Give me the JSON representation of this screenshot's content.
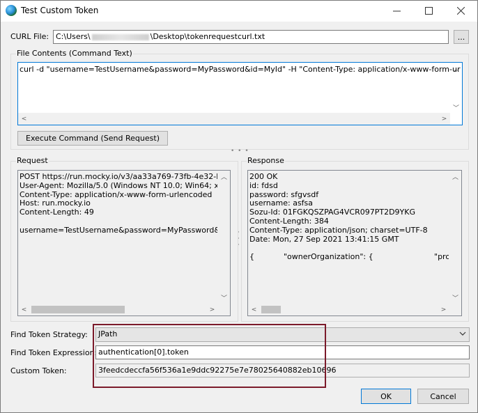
{
  "window": {
    "title": "Test Custom Token"
  },
  "curl_file": {
    "label": "CURL File:",
    "path_start": "C:\\Users\\",
    "path_end": "\\Desktop\\tokenrequestcurl.txt",
    "browse_label": "..."
  },
  "file_contents": {
    "title": "File Contents (Command Text)",
    "text": "curl -d \"username=TestUsername&password=MyPassword&id=MyId\" -H \"Content-Type: application/x-www-form-urlencoded\" -X PC",
    "execute_label": "Execute Command (Send Request)"
  },
  "request": {
    "title": "Request",
    "text": "POST https://run.mocky.io/v3/aa33a769-73fb-4e32-b766-c\nUser-Agent: Mozilla/5.0 (Windows NT 10.0; Win64; x64) SS\nContent-Type: application/x-www-form-urlencoded\nHost: run.mocky.io\nContent-Length: 49\n\nusername=TestUsername&password=MyPassword&id=MyId"
  },
  "response": {
    "title": "Response",
    "text": "200 OK\nid: fdsd\npassword: sfgvsdf\nusername: asfsa\nSozu-Id: 01FGKQSZPAG4VCR097PT2D9YKG\nContent-Length: 384\nContent-Type: application/json; charset=UTF-8\nDate: Mon, 27 Sep 2021 13:41:15 GMT\n\n{            \"ownerOrganization\": {                         \"providerl"
  },
  "strategy": {
    "label": "Find Token Strategy:",
    "value": "JPath"
  },
  "expression": {
    "label": "Find Token Expression:",
    "value": "authentication[0].token"
  },
  "custom_token": {
    "label": "Custom Token:",
    "value": "3feedcdeccfa56f536a1e9ddc92275e7e78025640882eb10696"
  },
  "buttons": {
    "ok": "OK",
    "cancel": "Cancel"
  },
  "icons": {
    "minimize": "minimize-icon",
    "maximize": "maximize-icon",
    "close": "close-icon",
    "app": "globe-icon",
    "scroll_left": "scroll-left-icon",
    "scroll_right": "scroll-right-icon",
    "scroll_up": "scroll-up-icon",
    "scroll_down": "scroll-down-icon",
    "dropdown": "chevron-down-icon"
  },
  "colors": {
    "highlight_border": "#7b1a2a",
    "focus_border": "#0078d7"
  }
}
